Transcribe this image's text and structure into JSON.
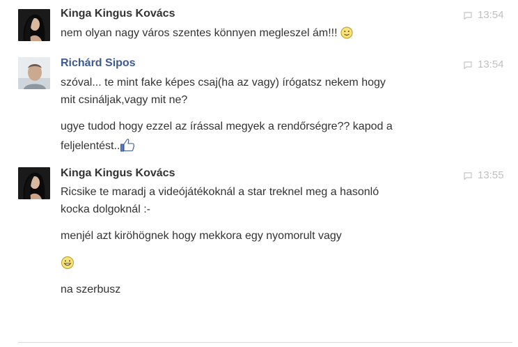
{
  "messages": [
    {
      "sender": "Kinga Kingus Kovács",
      "time": "13:54",
      "lines": [
        "nem olyan nagy város szentes könnyen megleszel ám!!!"
      ],
      "emoji_after_line0": "smiley-icon"
    },
    {
      "sender": "Richárd Sipos",
      "time": "13:54",
      "lines": [
        "szóval... te mint fake képes csaj(ha az vagy) írógatsz nekem hogy",
        "mit csináljak,vagy mit ne?",
        "ugye tudod hogy ezzel az írással megyek a rendőrségre?? kapod a",
        "feljelentést.."
      ],
      "emoji_after_line3": "thumbs-up-icon"
    },
    {
      "sender": "Kinga Kingus Kovács",
      "time": "13:55",
      "lines": [
        "Ricsike te maradj a videójátékoknál a star treknel meg a hasonló",
        "kocka dolgoknál :-",
        "menjél azt kiröhögnek hogy mekkora egy nyomorult vagy",
        "na szerbusz"
      ],
      "emoji_line": "grin-icon"
    }
  ],
  "colors": {
    "link_name": "#3b5998",
    "time": "#bfbfbf",
    "text": "#333333"
  }
}
